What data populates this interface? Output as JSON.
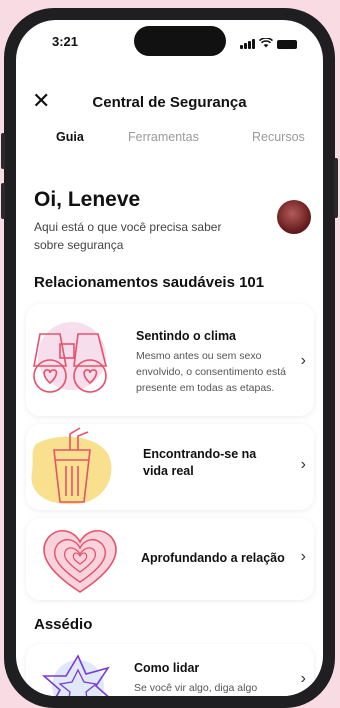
{
  "status": {
    "time": "3:21"
  },
  "header": {
    "title": "Central de Segurança",
    "close_icon": "close-icon"
  },
  "tabs": [
    {
      "label": "Guia",
      "active": true
    },
    {
      "label": "Ferramentas",
      "active": false
    },
    {
      "label": "Recursos",
      "active": false
    }
  ],
  "greeting": {
    "title": "Oi, Leneve",
    "subtitle": "Aqui está o que você precisa saber sobre segurança"
  },
  "sections": [
    {
      "title": "Relacionamentos saudáveis 101"
    },
    {
      "title": "Assédio"
    }
  ],
  "cards": [
    {
      "title": "Sentindo o clima",
      "desc": "Mesmo antes ou sem sexo envolvido, o consentimento está presente em todas as etapas.",
      "icon": "binoculars-icon"
    },
    {
      "title": "Encontrando-se na vida real",
      "desc": "",
      "icon": "drink-cup-icon"
    },
    {
      "title": "Aprofundando a relação",
      "desc": "",
      "icon": "hearts-icon"
    },
    {
      "title": "Como lidar",
      "desc": "Se você vir algo, diga algo",
      "icon": "star-burst-icon"
    }
  ],
  "colors": {
    "background": "#f8dbe3",
    "accent": "#e8506b",
    "highlight": "#f7d56a",
    "phone_frame": "#1f1f22"
  }
}
